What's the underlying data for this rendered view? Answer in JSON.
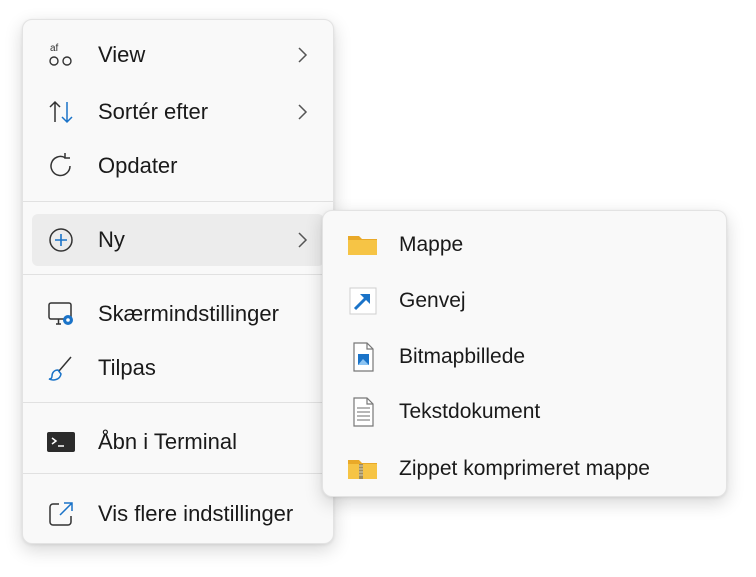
{
  "context_menu": {
    "items": [
      {
        "label": "View",
        "icon": "view-icon",
        "has_submenu": true
      },
      {
        "label": "Sortér efter",
        "icon": "sort-icon",
        "has_submenu": true
      },
      {
        "label": "Opdater",
        "icon": "refresh-icon",
        "has_submenu": false
      },
      {
        "label": "Ny",
        "icon": "new-icon",
        "has_submenu": true
      },
      {
        "label": "Skærmindstillinger",
        "icon": "display-settings-icon",
        "has_submenu": false
      },
      {
        "label": "Tilpas",
        "icon": "brush-icon",
        "has_submenu": false
      },
      {
        "label": "Åbn i Terminal",
        "icon": "terminal-icon",
        "has_submenu": false
      },
      {
        "label": "Vis flere indstillinger",
        "icon": "more-options-icon",
        "has_submenu": false
      }
    ],
    "view_icon_text": "af"
  },
  "submenu": {
    "items": [
      {
        "label": "Mappe",
        "icon": "folder-icon"
      },
      {
        "label": "Genvej",
        "icon": "shortcut-icon"
      },
      {
        "label": "Bitmapbillede",
        "icon": "bitmap-icon"
      },
      {
        "label": "Tekstdokument",
        "icon": "text-document-icon"
      },
      {
        "label": "Zippet komprimeret mappe",
        "icon": "zip-folder-icon"
      }
    ]
  },
  "colors": {
    "accent": "#1a73c8",
    "folder": "#f6c445",
    "menu_bg": "#f9f9f9",
    "hover": "#ececec"
  }
}
